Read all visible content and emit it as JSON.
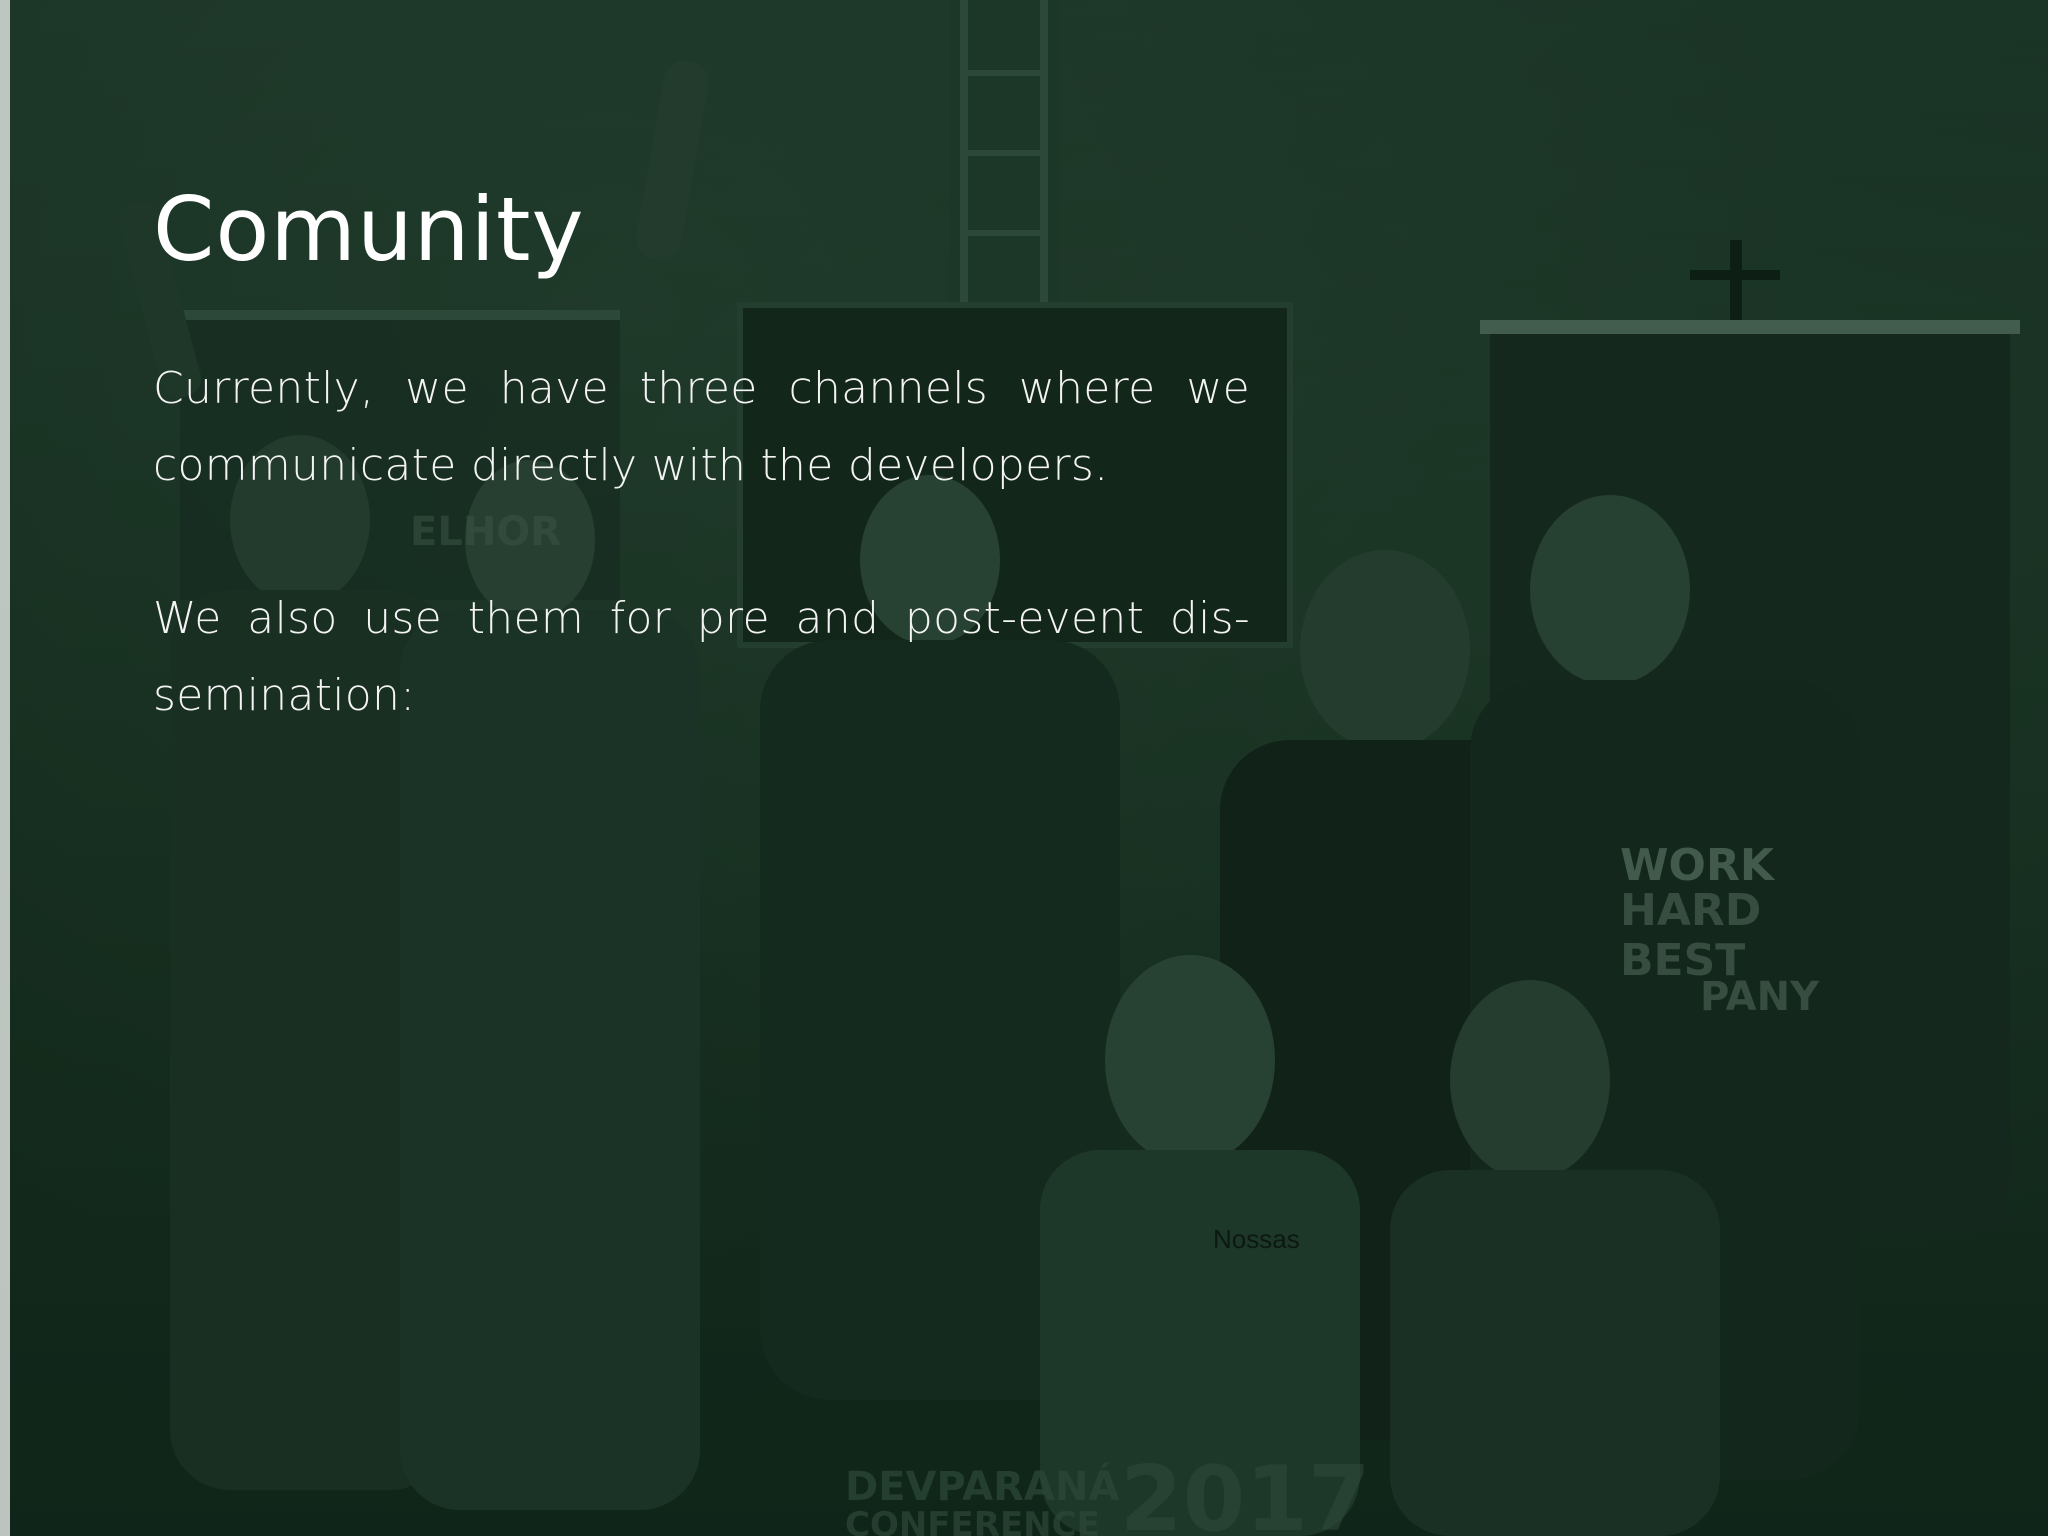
{
  "slide": {
    "title": "Comunity",
    "paragraphs": [
      "Currently, we have three channels where we communicate directly with the developers.",
      "We also use them for pre and post-event dis-semination:"
    ],
    "footnote": "Nossas"
  },
  "colors": {
    "overlay": "#1b3526",
    "text": "#ffffff"
  },
  "background": {
    "image_lettering": [
      "ELHOR",
      "WORK HARD BEST COMPANY",
      "DEVPARANÁ CONFERENCE 2017"
    ]
  }
}
